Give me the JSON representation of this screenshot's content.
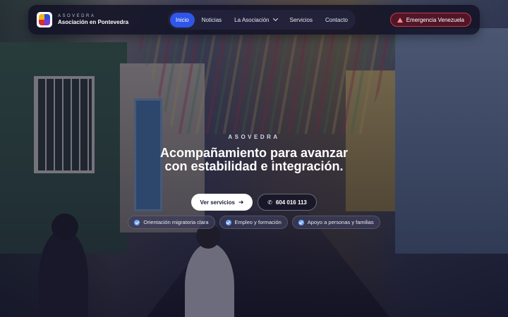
{
  "brand": {
    "tagline": "ASOVEDRA",
    "name": "Asociación en Pontevedra",
    "logo_colors": [
      "#f3b21b",
      "#2b4fd8",
      "#d72c3b",
      "#7b3bd1"
    ]
  },
  "nav": {
    "items": [
      {
        "label": "Inicio",
        "active": true
      },
      {
        "label": "Noticias"
      },
      {
        "label": "La Asociación",
        "dropdown": true
      },
      {
        "label": "Servicios"
      },
      {
        "label": "Contacto"
      }
    ],
    "emergency_label": "Emergencia Venezuela",
    "emergency_icon": "warning-icon",
    "accent": "#2f56e8",
    "emergency_color": "#c93a4c"
  },
  "hero": {
    "kicker": "ASOVEDRA",
    "headline_line1": "Acompañamiento para avanzar",
    "headline_line2": "con estabilidad e integración.",
    "cta_primary": "Ver servicios",
    "cta_primary_icon": "arrow-right-icon",
    "cta_secondary": "604 016 113",
    "cta_secondary_icon": "phone-icon",
    "chips": [
      {
        "label": "Orientación migratoria clara",
        "icon": "check-circle-icon"
      },
      {
        "label": "Empleo y formación",
        "icon": "check-circle-icon"
      },
      {
        "label": "Apoyo a personas y familias",
        "icon": "check-circle-icon"
      }
    ],
    "chip_icon_color": "#6fa6ff"
  }
}
